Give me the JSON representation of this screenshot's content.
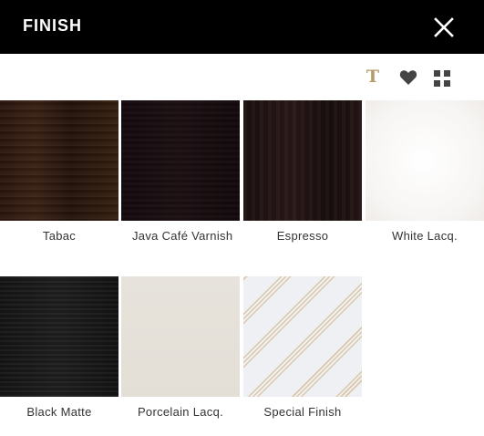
{
  "header": {
    "title": "FINISH",
    "close_icon": "close-icon"
  },
  "toolbar": {
    "text_icon_glyph": "T",
    "icons": [
      "text-icon",
      "heart-icon",
      "grid-icon"
    ],
    "accent_color": "#b79a6a"
  },
  "finishes": [
    {
      "label": "Tabac",
      "swatch": "dark brown wood"
    },
    {
      "label": "Java Café Varnish",
      "swatch": "near-black wood"
    },
    {
      "label": "Espresso",
      "swatch": "dark espresso wood"
    },
    {
      "label": "White Lacq.",
      "swatch": "white lacquer"
    },
    {
      "label": "Black Matte",
      "swatch": "black matte"
    },
    {
      "label": "Porcelain Lacq.",
      "swatch": "porcelain lacquer"
    },
    {
      "label": "Special Finish",
      "swatch": "diagonal stripes"
    }
  ]
}
